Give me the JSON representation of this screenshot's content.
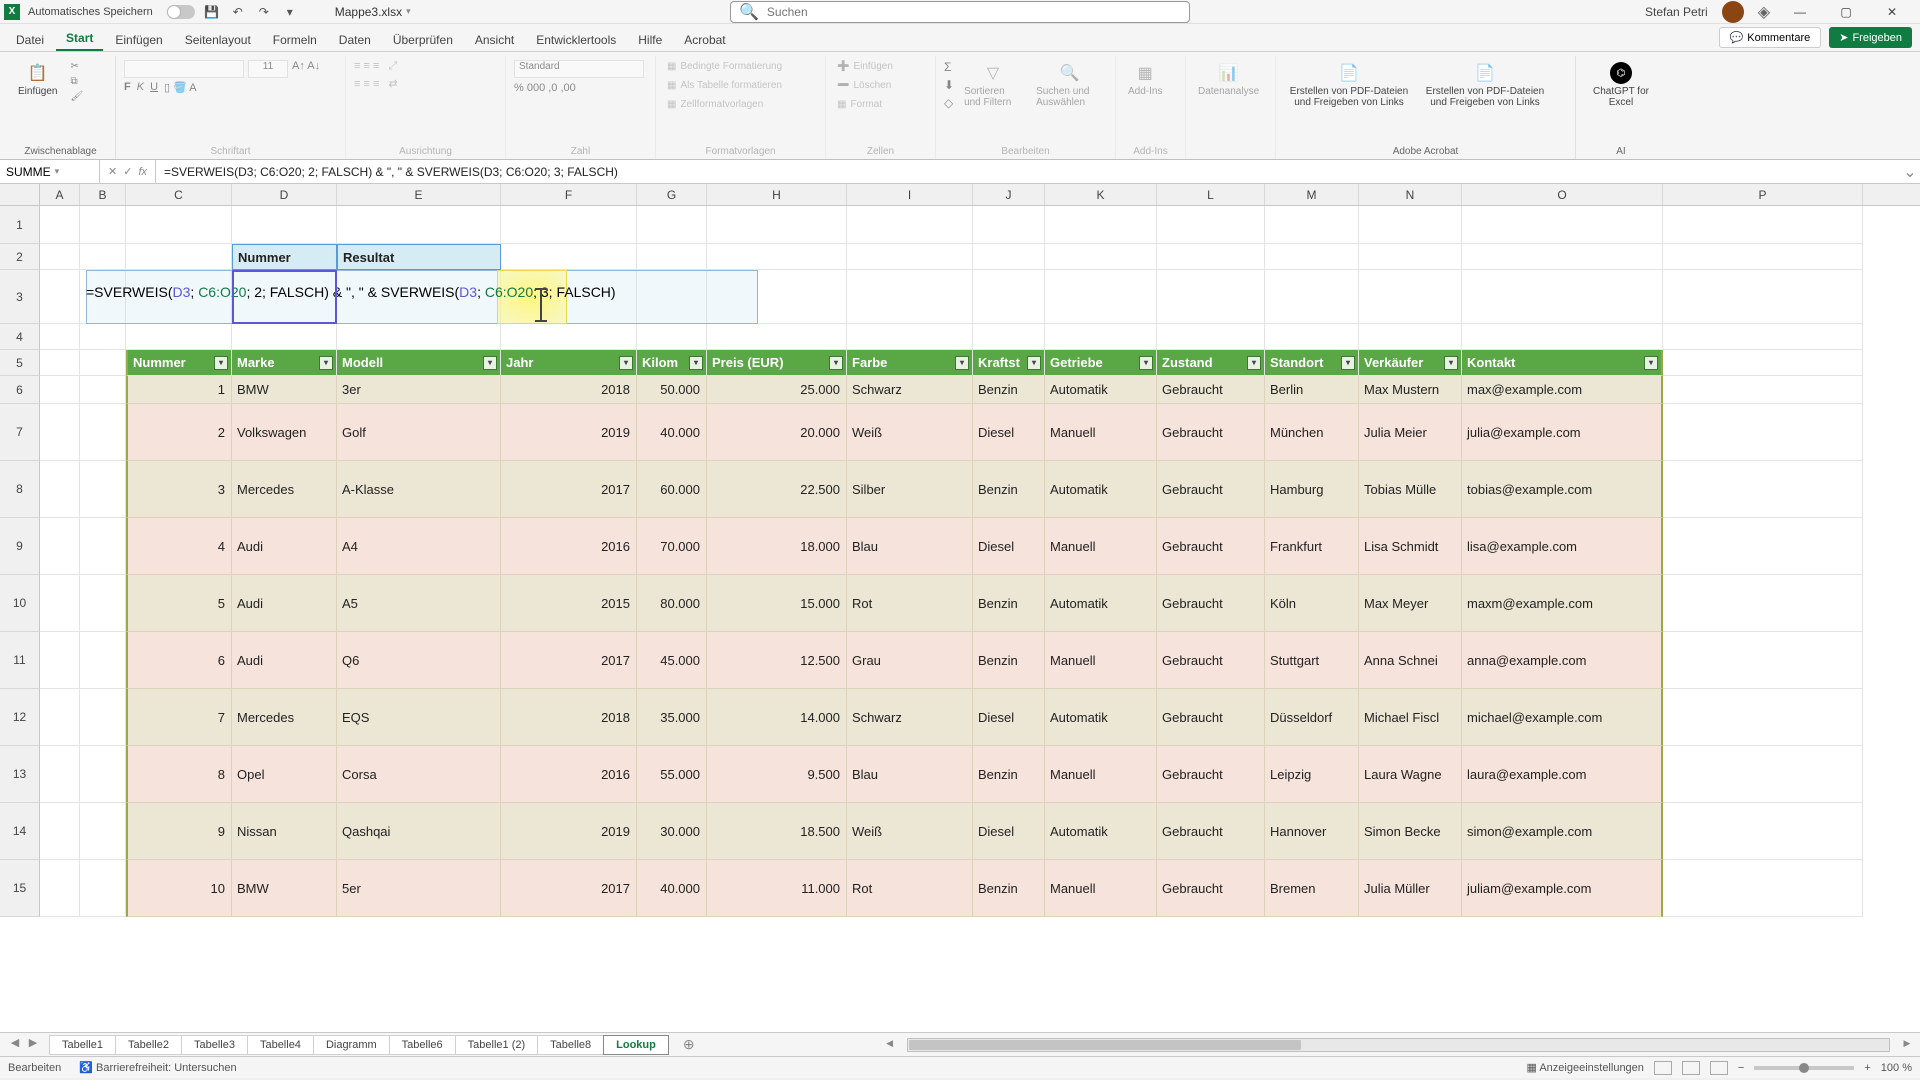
{
  "titlebar": {
    "autosave_label": "Automatisches Speichern",
    "filename": "Mappe3.xlsx",
    "search_placeholder": "Suchen",
    "user": "Stefan Petri"
  },
  "tabs": {
    "items": [
      "Datei",
      "Start",
      "Einfügen",
      "Seitenlayout",
      "Formeln",
      "Daten",
      "Überprüfen",
      "Ansicht",
      "Entwicklertools",
      "Hilfe",
      "Acrobat"
    ],
    "active_index": 1,
    "comments": "Kommentare",
    "share": "Freigeben"
  },
  "ribbon": {
    "groups": {
      "clipboard": {
        "label": "Zwischenablage",
        "paste": "Einfügen"
      },
      "font": {
        "label": "Schriftart"
      },
      "align": {
        "label": "Ausrichtung"
      },
      "number": {
        "label": "Zahl",
        "format": "Standard"
      },
      "styles": {
        "label": "Formatvorlagen",
        "cond": "Bedingte Formatierung",
        "astable": "Als Tabelle formatieren",
        "cellstyle": "Zellformatvorlagen"
      },
      "cells": {
        "label": "Zellen",
        "insert": "Einfügen",
        "delete": "Löschen",
        "format": "Format"
      },
      "edit": {
        "label": "Bearbeiten",
        "sortfilter": "Sortieren und Filtern",
        "findselect": "Suchen und Auswählen"
      },
      "addins": {
        "label": "Add-Ins",
        "addins": "Add-Ins"
      },
      "analysis": {
        "label": "",
        "data": "Datenanalyse"
      },
      "acrobat": {
        "label": "Adobe Acrobat",
        "create": "Erstellen von PDF-Dateien und Freigeben von Links",
        "share": "Erstellen von PDF-Dateien und Freigeben von Links"
      },
      "ai": {
        "label": "AI",
        "gpt": "ChatGPT for Excel"
      }
    }
  },
  "namebox": "SUMME",
  "formula": "=SVERWEIS(D3; C6:O20; 2; FALSCH) & \", \" & SVERWEIS(D3; C6:O20; 3; FALSCH)",
  "formula_parts": {
    "p1": "=SVERWEIS(",
    "d3a": "D3",
    "p2": "; ",
    "r1": "C6:O20",
    "p3": "; 2; FALSCH) & \", \" & SVERWEIS(",
    "d3b": "D3",
    "p4": "; ",
    "r2": "C6:O20",
    "p5": "; 3; FALSCH)"
  },
  "colheads": [
    "A",
    "B",
    "C",
    "D",
    "E",
    "F",
    "G",
    "H",
    "I",
    "J",
    "K",
    "L",
    "M",
    "N",
    "O",
    "P"
  ],
  "rowheads": [
    "1",
    "2",
    "3",
    "4",
    "5",
    "6",
    "7",
    "8",
    "9",
    "10",
    "11",
    "12",
    "13",
    "14",
    "15"
  ],
  "row2": {
    "nummer": "Nummer",
    "resultat": "Resultat"
  },
  "table_headers": [
    "Nummer",
    "Marke",
    "Modell",
    "Jahr",
    "Kilom",
    "Preis (EUR)",
    "Farbe",
    "Kraftst",
    "Getriebe",
    "Zustand",
    "Standort",
    "Verkäufer",
    "Kontakt"
  ],
  "chart_data": {
    "type": "table",
    "columns": [
      "Nummer",
      "Marke",
      "Modell",
      "Jahr",
      "Kilometer",
      "Preis (EUR)",
      "Farbe",
      "Kraftstoff",
      "Getriebe",
      "Zustand",
      "Standort",
      "Verkäufer",
      "Kontakt"
    ],
    "rows": [
      [
        1,
        "BMW",
        "3er",
        2018,
        "50.000",
        "25.000",
        "Schwarz",
        "Benzin",
        "Automatik",
        "Gebraucht",
        "Berlin",
        "Max Mustern",
        "max@example.com"
      ],
      [
        2,
        "Volkswagen",
        "Golf",
        2019,
        "40.000",
        "20.000",
        "Weiß",
        "Diesel",
        "Manuell",
        "Gebraucht",
        "München",
        "Julia Meier",
        "julia@example.com"
      ],
      [
        3,
        "Mercedes",
        "A-Klasse",
        2017,
        "60.000",
        "22.500",
        "Silber",
        "Benzin",
        "Automatik",
        "Gebraucht",
        "Hamburg",
        "Tobias Mülle",
        "tobias@example.com"
      ],
      [
        4,
        "Audi",
        "A4",
        2016,
        "70.000",
        "18.000",
        "Blau",
        "Diesel",
        "Manuell",
        "Gebraucht",
        "Frankfurt",
        "Lisa Schmidt",
        "lisa@example.com"
      ],
      [
        5,
        "Audi",
        "A5",
        2015,
        "80.000",
        "15.000",
        "Rot",
        "Benzin",
        "Automatik",
        "Gebraucht",
        "Köln",
        "Max Meyer",
        "maxm@example.com"
      ],
      [
        6,
        "Audi",
        "Q6",
        2017,
        "45.000",
        "12.500",
        "Grau",
        "Benzin",
        "Manuell",
        "Gebraucht",
        "Stuttgart",
        "Anna Schnei",
        "anna@example.com"
      ],
      [
        7,
        "Mercedes",
        "EQS",
        2018,
        "35.000",
        "14.000",
        "Schwarz",
        "Diesel",
        "Automatik",
        "Gebraucht",
        "Düsseldorf",
        "Michael Fiscl",
        "michael@example.com"
      ],
      [
        8,
        "Opel",
        "Corsa",
        2016,
        "55.000",
        "9.500",
        "Blau",
        "Benzin",
        "Manuell",
        "Gebraucht",
        "Leipzig",
        "Laura Wagne",
        "laura@example.com"
      ],
      [
        9,
        "Nissan",
        "Qashqai",
        2019,
        "30.000",
        "18.500",
        "Weiß",
        "Diesel",
        "Automatik",
        "Gebraucht",
        "Hannover",
        "Simon Becke",
        "simon@example.com"
      ],
      [
        10,
        "BMW",
        "5er",
        2017,
        "40.000",
        "11.000",
        "Rot",
        "Benzin",
        "Manuell",
        "Gebraucht",
        "Bremen",
        "Julia Müller",
        "juliam@example.com"
      ]
    ]
  },
  "sheets": {
    "items": [
      "Tabelle1",
      "Tabelle2",
      "Tabelle3",
      "Tabelle4",
      "Diagramm",
      "Tabelle6",
      "Tabelle1 (2)",
      "Tabelle8",
      "Lookup"
    ],
    "active_index": 8
  },
  "status": {
    "mode": "Bearbeiten",
    "access": "Barrierefreiheit: Untersuchen",
    "display": "Anzeigeeinstellungen",
    "zoom": "100 %"
  }
}
